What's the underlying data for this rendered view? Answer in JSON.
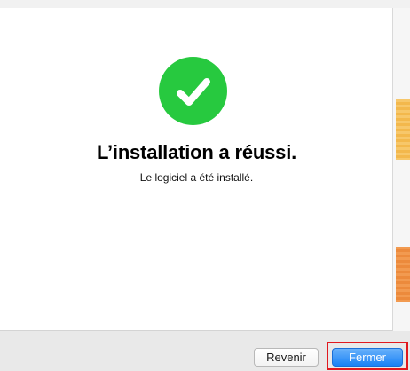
{
  "status": {
    "icon": "checkmark-icon",
    "accent_color": "#27c93f",
    "title": "L’installation a réussi.",
    "message": "Le logiciel a été installé."
  },
  "footer": {
    "back_label": "Revenir",
    "close_label": "Fermer",
    "primary_color": "#1a82f6"
  }
}
